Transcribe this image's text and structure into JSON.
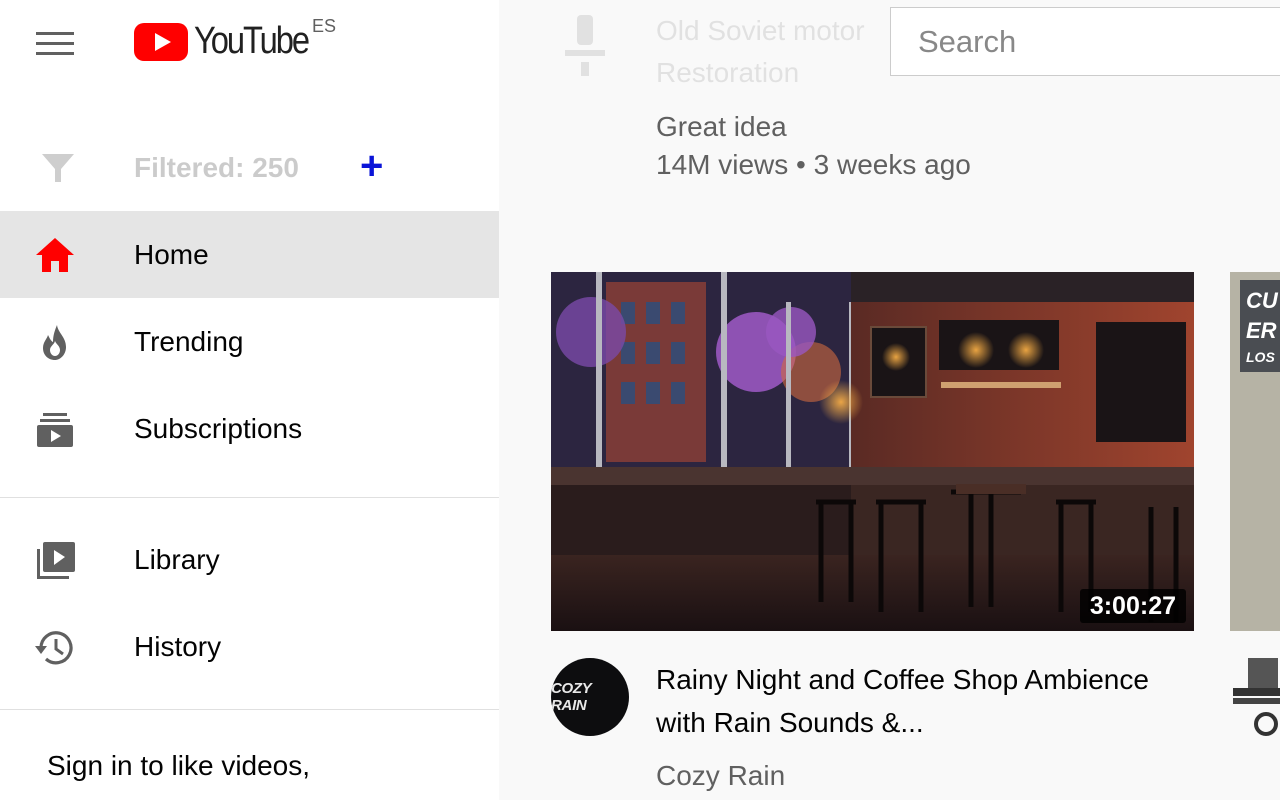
{
  "header": {
    "logo_text": "YouTube",
    "country_code": "ES",
    "search_placeholder": "Search"
  },
  "sidebar": {
    "filter_label": "Filtered: 250",
    "filter_add": "+",
    "items": [
      {
        "label": "Home",
        "icon": "home-icon",
        "active": true
      },
      {
        "label": "Trending",
        "icon": "flame-icon"
      },
      {
        "label": "Subscriptions",
        "icon": "subscriptions-icon"
      },
      {
        "label": "Library",
        "icon": "library-icon"
      },
      {
        "label": "History",
        "icon": "history-icon"
      }
    ],
    "signin_text": "Sign in to like videos,"
  },
  "main": {
    "previous_video": {
      "title_faded": "Old Soviet motor Restoration",
      "channel": "Great idea",
      "meta": "14M views • 3 weeks ago"
    },
    "video": {
      "duration": "3:00:27",
      "title": "Rainy Night and Coffee Shop Ambience with Rain Sounds &...",
      "channel": "Cozy Rain",
      "avatar_text": "COZY RAIN"
    },
    "next_video_banner": {
      "line1": "CU",
      "line2": "ER",
      "line3": "LOS"
    }
  },
  "colors": {
    "brand_red": "#ff0000",
    "active_bg": "#e5e5e5",
    "accent_blue": "#0a14d8"
  }
}
